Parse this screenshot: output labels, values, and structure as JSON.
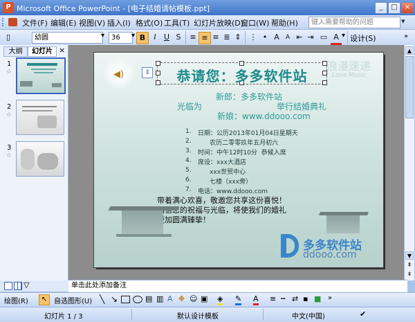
{
  "window": {
    "title": "Microsoft Office PowerPoint - [电子结婚请帖模板.ppt]",
    "app_icon": "P"
  },
  "menu": {
    "items": [
      "文件(F)",
      "编辑(E)",
      "视图(V)",
      "插入(I)",
      "格式(O)",
      "工具(T)",
      "幻灯片放映(D)",
      "窗口(W)",
      "帮助(H)"
    ],
    "help_placeholder": "键入需要帮助的问题"
  },
  "toolbar": {
    "font_name": "幼圆",
    "font_size": "36",
    "bold": "B",
    "italic": "I",
    "underline": "U",
    "shadow": "S",
    "design_label": "设计(S)"
  },
  "left_pane": {
    "tab_outline": "大纲",
    "tab_slides": "幻灯片",
    "close": "×",
    "slides": [
      {
        "num": "1",
        "star": "☆"
      },
      {
        "num": "2",
        "star": "☆"
      },
      {
        "num": "3",
        "star": "☆"
      }
    ]
  },
  "slide": {
    "title": "恭请您：多多软件站",
    "watermark_line1": "浪漫速递",
    "watermark_line2": "Love Music",
    "groom": "新郎：多多软件站",
    "invite_left": "光临为",
    "invite_right": "举行结婚典礼",
    "bride": "新娘：www.ddooo.com",
    "details": [
      {
        "num": "1.",
        "text": "日期：公历2013年01月04日星期天"
      },
      {
        "num": "2.",
        "text": "      农历二零零玖年五月初六"
      },
      {
        "num": "3.",
        "text": "时间：中午12时10分  恭候入席"
      },
      {
        "num": "4.",
        "text": "席设：xxx大酒店"
      },
      {
        "num": "5.",
        "text": "      xxx世贸中心"
      },
      {
        "num": "6.",
        "text": "      七楼（xxx旁）"
      },
      {
        "num": "7.",
        "text": "电话：www.ddooo.com"
      }
    ],
    "closing": [
      "带着满心欢喜，敬邀您共享这份喜悦！",
      "相信您的祝福与光临，将使我们的婚礼",
      "更加圆满臻挚！"
    ],
    "brand_cn": "多多软件站",
    "brand_url": "ddooo.com"
  },
  "notes": {
    "placeholder": "单击此处添加备注"
  },
  "drawbar": {
    "draw_label": "绘图(R)",
    "autoshape_label": "自选图形(U)"
  },
  "status": {
    "slide_info": "幻灯片 1 / 3",
    "design": "默认设计模板",
    "language": "中文(中国)"
  },
  "colors": {
    "title_teal": "#1f8c8c",
    "text_dark": "#1c3a3a"
  }
}
